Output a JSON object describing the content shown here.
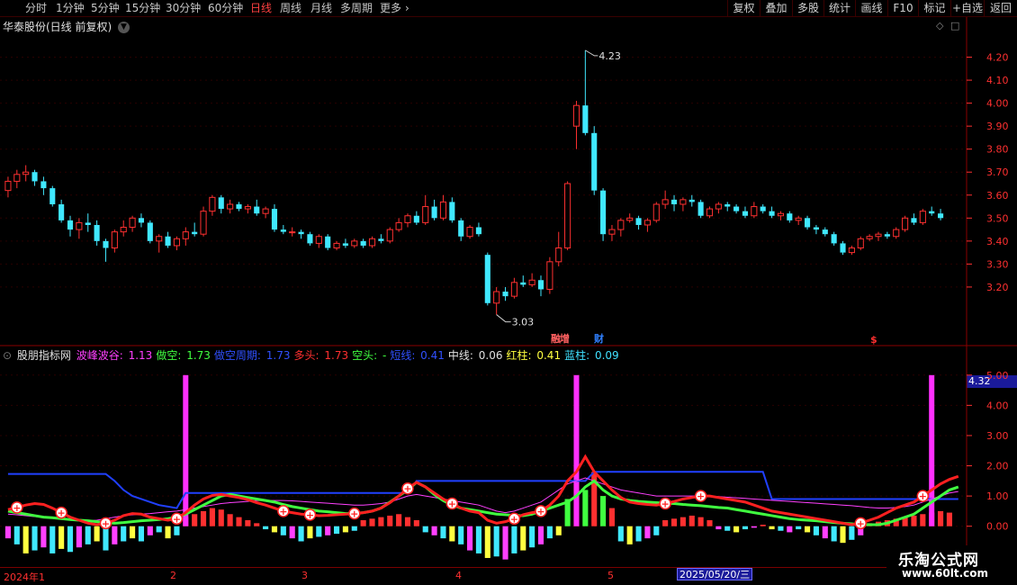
{
  "toolbar": {
    "periods": [
      "分时",
      "1分钟",
      "5分钟",
      "15分钟",
      "30分钟",
      "60分钟",
      "日线",
      "周线",
      "月线",
      "多周期",
      "更多"
    ],
    "active_period": "日线",
    "more_arrow": "›",
    "right_buttons": [
      "复权",
      "叠加",
      "多股",
      "统计",
      "画线",
      "F10",
      "标记",
      "+自选",
      "返回"
    ]
  },
  "main_panel": {
    "title": "华泰股份(日线 前复权)",
    "icons": [
      "diamond-icon",
      "square-icon"
    ],
    "high_label": "4.23",
    "low_label": "3.03",
    "markers": [
      {
        "text": "融",
        "color": "#ff6060"
      },
      {
        "text": "增",
        "color": "#ff6060"
      },
      {
        "text": "财",
        "color": "#3080ff"
      },
      {
        "text": "$",
        "color": "#ff3030"
      }
    ]
  },
  "indicator_panel": {
    "name": "股朋指标网",
    "values": [
      {
        "label": "波峰波谷",
        "value": "1.13",
        "color": "#ff40ff"
      },
      {
        "label": "做空",
        "value": "1.73",
        "color": "#40ff40"
      },
      {
        "label": "做空周期",
        "value": "1.73",
        "color": "#3050ff"
      },
      {
        "label": "多头",
        "value": "1.73",
        "color": "#ff3030"
      },
      {
        "label": "空头",
        "value": "-",
        "color": "#40ff40"
      },
      {
        "label": "短线",
        "value": "0.41",
        "color": "#3050ff"
      },
      {
        "label": "中线",
        "value": "0.06",
        "color": "#e0e0e0"
      },
      {
        "label": "红柱",
        "value": "0.41",
        "color": "#ffff40"
      },
      {
        "label": "蓝柱",
        "value": "0.09",
        "color": "#40e0ff"
      }
    ],
    "current_value": "4.32",
    "buy_marker": "+"
  },
  "price_axis": {
    "labels": [
      "4.20",
      "4.10",
      "4.00",
      "3.90",
      "3.80",
      "3.70",
      "3.60",
      "3.50",
      "3.40",
      "3.30",
      "3.20"
    ],
    "ylim": [
      3.0,
      4.3
    ]
  },
  "indicator_axis": {
    "labels": [
      "5.00",
      "4.00",
      "3.00",
      "2.00",
      "1.00",
      "0.00"
    ],
    "ylim": [
      -1.2,
      5.5
    ]
  },
  "date_axis": {
    "labels": [
      {
        "text": "2024年1",
        "pos": 4
      },
      {
        "text": "2",
        "pos": 189
      },
      {
        "text": "3",
        "pos": 335
      },
      {
        "text": "4",
        "pos": 506
      },
      {
        "text": "5",
        "pos": 675
      }
    ],
    "cursor_label": "2025/05/20/三"
  },
  "watermark": {
    "line1": "乐淘公式网",
    "line2": "www.60lt.com"
  },
  "chart_data": {
    "type": "candlestick",
    "title": "华泰股份(日线 前复权)",
    "ylim": [
      3.0,
      4.3
    ],
    "up_color": "#ff3030",
    "down_color": "#40e8ff",
    "candles": [
      [
        3.62,
        3.68,
        3.59,
        3.66
      ],
      [
        3.66,
        3.71,
        3.63,
        3.69
      ],
      [
        3.69,
        3.73,
        3.66,
        3.7
      ],
      [
        3.7,
        3.71,
        3.64,
        3.66
      ],
      [
        3.66,
        3.68,
        3.6,
        3.63
      ],
      [
        3.63,
        3.64,
        3.55,
        3.56
      ],
      [
        3.56,
        3.58,
        3.48,
        3.49
      ],
      [
        3.49,
        3.51,
        3.42,
        3.45
      ],
      [
        3.45,
        3.5,
        3.41,
        3.48
      ],
      [
        3.48,
        3.52,
        3.44,
        3.47
      ],
      [
        3.47,
        3.49,
        3.38,
        3.4
      ],
      [
        3.4,
        3.41,
        3.31,
        3.37
      ],
      [
        3.37,
        3.45,
        3.35,
        3.44
      ],
      [
        3.44,
        3.49,
        3.42,
        3.46
      ],
      [
        3.46,
        3.51,
        3.44,
        3.5
      ],
      [
        3.5,
        3.52,
        3.46,
        3.48
      ],
      [
        3.48,
        3.49,
        3.39,
        3.4
      ],
      [
        3.4,
        3.43,
        3.35,
        3.42
      ],
      [
        3.42,
        3.44,
        3.37,
        3.38
      ],
      [
        3.38,
        3.42,
        3.36,
        3.41
      ],
      [
        3.41,
        3.46,
        3.38,
        3.44
      ],
      [
        3.44,
        3.48,
        3.42,
        3.43
      ],
      [
        3.43,
        3.55,
        3.42,
        3.53
      ],
      [
        3.53,
        3.6,
        3.51,
        3.59
      ],
      [
        3.59,
        3.6,
        3.52,
        3.54
      ],
      [
        3.54,
        3.58,
        3.52,
        3.56
      ],
      [
        3.56,
        3.57,
        3.53,
        3.54
      ],
      [
        3.54,
        3.56,
        3.52,
        3.55
      ],
      [
        3.55,
        3.58,
        3.51,
        3.52
      ],
      [
        3.52,
        3.55,
        3.5,
        3.54
      ],
      [
        3.54,
        3.56,
        3.44,
        3.45
      ],
      [
        3.45,
        3.47,
        3.43,
        3.44
      ],
      [
        3.44,
        3.46,
        3.42,
        3.44
      ],
      [
        3.44,
        3.45,
        3.41,
        3.43
      ],
      [
        3.43,
        3.44,
        3.38,
        3.39
      ],
      [
        3.39,
        3.43,
        3.37,
        3.42
      ],
      [
        3.42,
        3.43,
        3.36,
        3.37
      ],
      [
        3.37,
        3.4,
        3.36,
        3.39
      ],
      [
        3.39,
        3.41,
        3.37,
        3.38
      ],
      [
        3.38,
        3.41,
        3.37,
        3.4
      ],
      [
        3.4,
        3.41,
        3.37,
        3.38
      ],
      [
        3.38,
        3.42,
        3.37,
        3.41
      ],
      [
        3.41,
        3.43,
        3.39,
        3.4
      ],
      [
        3.4,
        3.46,
        3.39,
        3.45
      ],
      [
        3.45,
        3.5,
        3.44,
        3.48
      ],
      [
        3.48,
        3.52,
        3.46,
        3.51
      ],
      [
        3.51,
        3.53,
        3.47,
        3.48
      ],
      [
        3.48,
        3.6,
        3.47,
        3.55
      ],
      [
        3.55,
        3.58,
        3.49,
        3.5
      ],
      [
        3.5,
        3.6,
        3.49,
        3.57
      ],
      [
        3.57,
        3.59,
        3.48,
        3.49
      ],
      [
        3.49,
        3.5,
        3.4,
        3.42
      ],
      [
        3.42,
        3.47,
        3.41,
        3.46
      ],
      [
        3.46,
        3.48,
        3.42,
        3.43
      ],
      [
        3.34,
        3.35,
        3.12,
        3.13
      ],
      [
        3.13,
        3.2,
        3.08,
        3.18
      ],
      [
        3.18,
        3.2,
        3.14,
        3.16
      ],
      [
        3.16,
        3.24,
        3.15,
        3.22
      ],
      [
        3.22,
        3.25,
        3.2,
        3.21
      ],
      [
        3.21,
        3.26,
        3.2,
        3.23
      ],
      [
        3.23,
        3.25,
        3.16,
        3.19
      ],
      [
        3.19,
        3.33,
        3.17,
        3.31
      ],
      [
        3.31,
        3.44,
        3.29,
        3.37
      ],
      [
        3.37,
        3.66,
        3.36,
        3.65
      ],
      [
        3.9,
        4.01,
        3.8,
        3.99
      ],
      [
        3.99,
        4.23,
        3.86,
        3.87
      ],
      [
        3.87,
        3.9,
        3.6,
        3.62
      ],
      [
        3.62,
        3.63,
        3.4,
        3.43
      ],
      [
        3.43,
        3.47,
        3.4,
        3.45
      ],
      [
        3.45,
        3.5,
        3.42,
        3.49
      ],
      [
        3.49,
        3.52,
        3.48,
        3.5
      ],
      [
        3.5,
        3.51,
        3.45,
        3.47
      ],
      [
        3.47,
        3.5,
        3.44,
        3.49
      ],
      [
        3.49,
        3.57,
        3.48,
        3.56
      ],
      [
        3.56,
        3.62,
        3.54,
        3.58
      ],
      [
        3.58,
        3.6,
        3.53,
        3.56
      ],
      [
        3.56,
        3.59,
        3.53,
        3.58
      ],
      [
        3.58,
        3.6,
        3.55,
        3.57
      ],
      [
        3.57,
        3.58,
        3.5,
        3.51
      ],
      [
        3.51,
        3.55,
        3.5,
        3.54
      ],
      [
        3.54,
        3.57,
        3.52,
        3.56
      ],
      [
        3.56,
        3.57,
        3.53,
        3.55
      ],
      [
        3.55,
        3.56,
        3.52,
        3.53
      ],
      [
        3.53,
        3.55,
        3.5,
        3.51
      ],
      [
        3.51,
        3.57,
        3.5,
        3.55
      ],
      [
        3.55,
        3.56,
        3.52,
        3.53
      ],
      [
        3.53,
        3.55,
        3.5,
        3.51
      ],
      [
        3.51,
        3.53,
        3.49,
        3.52
      ],
      [
        3.52,
        3.53,
        3.48,
        3.49
      ],
      [
        3.49,
        3.51,
        3.47,
        3.5
      ],
      [
        3.5,
        3.51,
        3.45,
        3.46
      ],
      [
        3.46,
        3.47,
        3.43,
        3.45
      ],
      [
        3.45,
        3.46,
        3.42,
        3.43
      ],
      [
        3.43,
        3.44,
        3.38,
        3.39
      ],
      [
        3.39,
        3.4,
        3.34,
        3.35
      ],
      [
        3.35,
        3.38,
        3.34,
        3.37
      ],
      [
        3.37,
        3.42,
        3.36,
        3.41
      ],
      [
        3.41,
        3.43,
        3.4,
        3.42
      ],
      [
        3.42,
        3.44,
        3.4,
        3.43
      ],
      [
        3.43,
        3.44,
        3.41,
        3.42
      ],
      [
        3.42,
        3.46,
        3.41,
        3.45
      ],
      [
        3.45,
        3.51,
        3.44,
        3.5
      ],
      [
        3.5,
        3.52,
        3.47,
        3.48
      ],
      [
        3.48,
        3.54,
        3.47,
        3.53
      ],
      [
        3.53,
        3.55,
        3.51,
        3.52
      ],
      [
        3.52,
        3.54,
        3.49,
        3.5
      ]
    ],
    "indicator": {
      "ylim": [
        -1.2,
        5.5
      ],
      "red_line": [
        0.55,
        0.62,
        0.7,
        0.75,
        0.72,
        0.6,
        0.45,
        0.3,
        0.2,
        0.1,
        0.05,
        0.1,
        0.2,
        0.35,
        0.42,
        0.4,
        0.3,
        0.25,
        0.2,
        0.25,
        0.45,
        0.7,
        0.9,
        1.02,
        1.05,
        1.0,
        0.95,
        0.88,
        0.78,
        0.7,
        0.6,
        0.5,
        0.45,
        0.4,
        0.38,
        0.35,
        0.36,
        0.38,
        0.4,
        0.42,
        0.45,
        0.5,
        0.6,
        0.78,
        1.0,
        1.25,
        1.45,
        1.3,
        1.1,
        0.9,
        0.75,
        0.6,
        0.5,
        0.45,
        0.2,
        0.1,
        0.15,
        0.25,
        0.38,
        0.45,
        0.5,
        0.7,
        1.0,
        1.5,
        1.8,
        2.3,
        1.8,
        1.5,
        1.2,
        0.95,
        0.8,
        0.75,
        0.72,
        0.7,
        0.75,
        0.82,
        0.9,
        0.95,
        1.0,
        1.0,
        0.95,
        0.9,
        0.85,
        0.8,
        0.7,
        0.6,
        0.5,
        0.45,
        0.4,
        0.35,
        0.3,
        0.25,
        0.2,
        0.15,
        0.1,
        0.05,
        0.1,
        0.2,
        0.3,
        0.45,
        0.6,
        0.7,
        0.8,
        1.0,
        1.2,
        1.4,
        1.55,
        1.65
      ],
      "green_line": [
        0.5,
        0.45,
        0.4,
        0.35,
        0.3,
        0.28,
        0.25,
        0.22,
        0.2,
        0.18,
        0.15,
        0.12,
        0.1,
        0.12,
        0.15,
        0.18,
        0.2,
        0.22,
        0.25,
        0.3,
        0.4,
        0.55,
        0.7,
        0.85,
        1.0,
        1.05,
        1.0,
        0.95,
        0.9,
        0.85,
        0.8,
        0.72,
        0.65,
        0.6,
        0.55,
        0.5,
        0.48,
        0.45,
        0.42,
        0.42,
        0.45,
        0.5,
        0.6,
        0.8,
        1.0,
        1.2,
        1.45,
        1.3,
        1.05,
        0.85,
        0.7,
        0.6,
        0.55,
        0.5,
        0.45,
        0.4,
        0.38,
        0.36,
        0.35,
        0.4,
        0.5,
        0.6,
        0.7,
        0.8,
        1.0,
        1.3,
        1.5,
        1.2,
        1.0,
        0.9,
        0.85,
        0.82,
        0.8,
        0.78,
        0.76,
        0.75,
        0.72,
        0.7,
        0.68,
        0.65,
        0.62,
        0.6,
        0.55,
        0.5,
        0.45,
        0.4,
        0.35,
        0.3,
        0.25,
        0.22,
        0.2,
        0.18,
        0.15,
        0.12,
        0.1,
        0.08,
        0.05,
        0.05,
        0.05,
        0.1,
        0.2,
        0.3,
        0.4,
        0.6,
        0.8,
        1.0,
        1.2,
        1.3
      ],
      "blue_line": [
        1.73,
        1.73,
        1.73,
        1.73,
        1.73,
        1.73,
        1.73,
        1.73,
        1.73,
        1.73,
        1.73,
        1.73,
        1.5,
        1.2,
        1.0,
        0.9,
        0.8,
        0.7,
        0.65,
        0.6,
        1.1,
        1.1,
        1.1,
        1.1,
        1.1,
        1.1,
        1.1,
        1.1,
        1.1,
        1.1,
        1.1,
        1.1,
        1.1,
        1.1,
        1.1,
        1.1,
        1.1,
        1.1,
        1.1,
        1.1,
        1.1,
        1.1,
        1.1,
        1.1,
        1.1,
        1.1,
        1.5,
        1.5,
        1.5,
        1.5,
        1.5,
        1.5,
        1.5,
        1.5,
        1.5,
        1.5,
        1.5,
        1.5,
        1.5,
        1.5,
        1.5,
        1.5,
        1.5,
        1.5,
        1.5,
        1.5,
        1.8,
        1.8,
        1.8,
        1.8,
        1.8,
        1.8,
        1.8,
        1.8,
        1.8,
        1.8,
        1.8,
        1.8,
        1.8,
        1.8,
        1.8,
        1.8,
        1.8,
        1.8,
        1.8,
        1.8,
        0.9,
        0.9,
        0.9,
        0.9,
        0.9,
        0.9,
        0.9,
        0.9,
        0.9,
        0.9,
        0.9,
        0.9,
        0.9,
        0.9,
        0.9,
        0.9,
        0.9,
        0.9,
        0.9,
        0.9,
        0.9,
        0.9
      ],
      "magenta_line": [
        0.4,
        0.38,
        0.35,
        0.32,
        0.3,
        0.28,
        0.25,
        0.22,
        0.2,
        0.18,
        0.2,
        0.25,
        0.3,
        0.35,
        0.38,
        0.4,
        0.42,
        0.45,
        0.48,
        0.5,
        0.55,
        0.6,
        0.65,
        0.7,
        0.75,
        0.78,
        0.8,
        0.82,
        0.85,
        0.85,
        0.85,
        0.85,
        0.84,
        0.82,
        0.8,
        0.78,
        0.76,
        0.74,
        0.72,
        0.7,
        0.7,
        0.72,
        0.75,
        0.8,
        0.9,
        1.0,
        1.05,
        1.0,
        0.95,
        0.9,
        0.85,
        0.8,
        0.75,
        0.7,
        0.6,
        0.5,
        0.45,
        0.5,
        0.6,
        0.7,
        0.8,
        1.0,
        1.2,
        1.4,
        1.5,
        1.6,
        1.5,
        1.4,
        1.3,
        1.2,
        1.15,
        1.1,
        1.05,
        1.0,
        1.0,
        1.0,
        1.0,
        1.0,
        1.0,
        1.0,
        0.98,
        0.96,
        0.94,
        0.92,
        0.9,
        0.88,
        0.86,
        0.84,
        0.82,
        0.8,
        0.78,
        0.76,
        0.74,
        0.72,
        0.7,
        0.68,
        0.65,
        0.62,
        0.6,
        0.6,
        0.62,
        0.65,
        0.7,
        0.8,
        0.9,
        1.0,
        1.1,
        1.15
      ],
      "bars": [
        -0.4,
        -0.6,
        -0.9,
        -0.8,
        -0.7,
        -0.9,
        -0.75,
        -0.85,
        -0.7,
        -0.6,
        -0.5,
        -0.8,
        -0.6,
        -0.5,
        -0.4,
        -0.5,
        -0.3,
        -0.2,
        -0.4,
        -0.3,
        0.3,
        0.4,
        0.5,
        0.6,
        0.55,
        0.4,
        0.3,
        0.2,
        0.1,
        -0.1,
        -0.2,
        -0.3,
        -0.4,
        -0.5,
        -0.4,
        -0.35,
        -0.3,
        -0.25,
        -0.2,
        -0.15,
        0.2,
        0.25,
        0.3,
        0.35,
        0.4,
        0.3,
        0.2,
        -0.2,
        -0.3,
        -0.4,
        -0.5,
        -0.6,
        -0.8,
        -0.9,
        -1.05,
        -1.0,
        -1.1,
        -0.9,
        -0.8,
        -0.7,
        -0.6,
        -0.4,
        -0.3,
        0.9,
        1.5,
        1.2,
        1.8,
        1.0,
        0.6,
        -0.5,
        -0.6,
        -0.5,
        -0.4,
        -0.3,
        0.2,
        0.25,
        0.3,
        0.35,
        0.3,
        0.2,
        -0.1,
        -0.15,
        -0.2,
        -0.1,
        -0.05,
        0.05,
        -0.1,
        -0.15,
        -0.2,
        -0.1,
        -0.2,
        -0.3,
        -0.4,
        -0.5,
        -0.55,
        -0.45,
        -0.3,
        0.1,
        0.15,
        0.2,
        0.25,
        0.3,
        0.35,
        0.4,
        0.45,
        0.5,
        0.45
      ],
      "spikes": [
        20,
        64,
        104
      ],
      "buy_markers": [
        1,
        6,
        11,
        19,
        31,
        34,
        39,
        45,
        50,
        57,
        60,
        74,
        78,
        96,
        103
      ]
    }
  }
}
